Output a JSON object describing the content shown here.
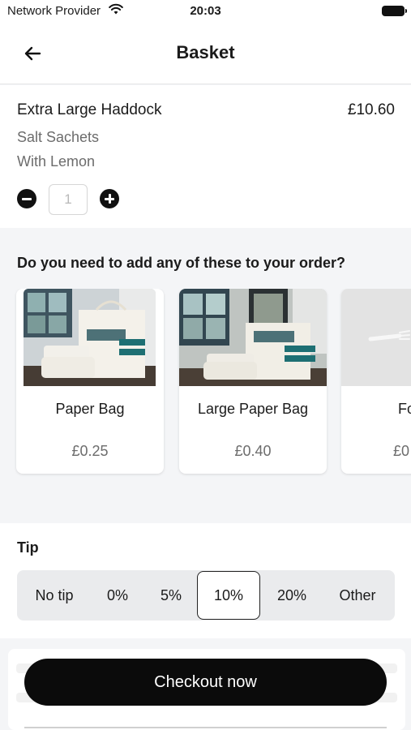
{
  "status_bar": {
    "carrier": "Network Provider",
    "time": "20:03"
  },
  "nav": {
    "title": "Basket"
  },
  "basket_item": {
    "name": "Extra Large Haddock",
    "price": "£10.60",
    "options": [
      "Salt Sachets",
      "With Lemon"
    ],
    "quantity": "1"
  },
  "upsell": {
    "heading": "Do you need to add any of these to your order?",
    "items": [
      {
        "name": "Paper Bag",
        "price": "£0.25"
      },
      {
        "name": "Large Paper Bag",
        "price": "£0.40"
      },
      {
        "name": "Fo",
        "price": "£0"
      }
    ]
  },
  "tip": {
    "title": "Tip",
    "options": [
      "No tip",
      "0%",
      "5%",
      "10%",
      "20%",
      "Other"
    ],
    "selected": "10%"
  },
  "checkout": {
    "label": "Checkout now"
  },
  "colors": {
    "accent": "#0b0b0b",
    "background": "#f4f5f7"
  },
  "icons": {
    "back": "arrow-left-icon",
    "wifi": "wifi-icon",
    "battery": "battery-icon",
    "minus": "minus-circle-icon",
    "plus": "plus-circle-icon"
  }
}
